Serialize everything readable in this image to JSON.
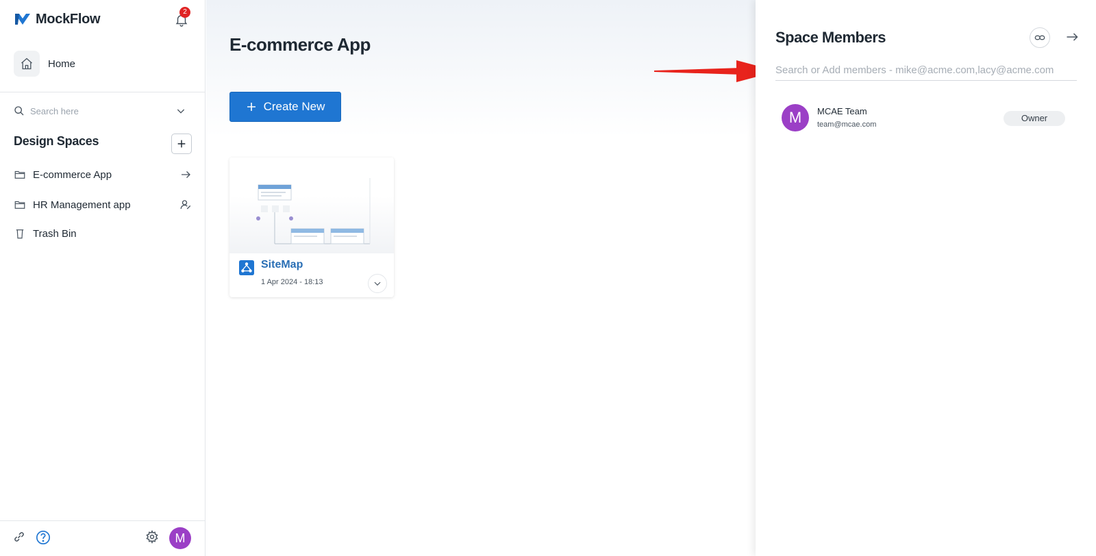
{
  "brand": {
    "name": "MockFlow",
    "color": "#1f76d2"
  },
  "notifications": {
    "count": "2"
  },
  "sidebar": {
    "home_label": "Home",
    "search_placeholder": "Search here",
    "design_spaces_title": "Design Spaces",
    "items": [
      {
        "label": "E-commerce App",
        "icon": "folder-icon",
        "action_icon": "arrow-right-icon"
      },
      {
        "label": "HR Management app",
        "icon": "folder-icon",
        "action_icon": "user-edit-icon"
      },
      {
        "label": "Trash Bin",
        "icon": "trash-icon"
      }
    ],
    "footer": {
      "avatar_letter": "M"
    }
  },
  "main": {
    "title": "E-commerce App",
    "create_label": "Create New",
    "cards": [
      {
        "title": "SiteMap",
        "date": "1 Apr 2024 - 18:13"
      }
    ]
  },
  "panel": {
    "title": "Space Members",
    "search_placeholder": "Search or Add members - mike@acme.com,lacy@acme.com",
    "members": [
      {
        "avatar_letter": "M",
        "name": "MCAE Team",
        "email": "team@mcae.com",
        "role": "Owner"
      }
    ]
  },
  "colors": {
    "accent": "#1f76d2",
    "avatar": "#9b3fc6",
    "badge": "#e02424",
    "annotation_arrow": "#e8231c"
  }
}
